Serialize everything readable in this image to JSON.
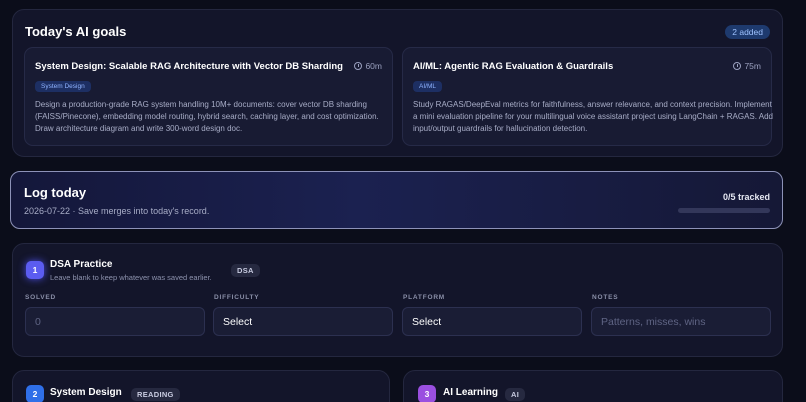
{
  "goals": {
    "title": "Today's AI goals",
    "added_badge": "2 added",
    "items": [
      {
        "title": "System Design: Scalable RAG Architecture with Vector DB Sharding",
        "time": "60m",
        "tag": "System Design",
        "description": "Design a production-grade RAG system handling 10M+ documents: cover vector DB sharding (FAISS/Pinecone), embedding model routing, hybrid search, caching layer, and cost optimization. Draw architecture diagram and write 300-word design doc."
      },
      {
        "title": "AI/ML: Agentic RAG Evaluation & Guardrails",
        "time": "75m",
        "tag": "AI/ML",
        "description": "Study RAGAS/DeepEval metrics for faithfulness, answer relevance, and context precision. Implement a mini evaluation pipeline for your multilingual voice assistant project using LangChain + RAGAS. Add input/output guardrails for hallucination detection."
      }
    ]
  },
  "log": {
    "title": "Log today",
    "subtitle": "2026-07-22 · Save merges into today's record.",
    "tracked": "0/5 tracked",
    "progress_fraction": 0
  },
  "dsa": {
    "number": "1",
    "title": "DSA Practice",
    "subtitle": "Leave blank to keep whatever was saved earlier.",
    "badge": "DSA",
    "fields": {
      "solved_label": "SOLVED",
      "solved_placeholder": "0",
      "difficulty_label": "DIFFICULTY",
      "difficulty_value": "Select",
      "platform_label": "PLATFORM",
      "platform_value": "Select",
      "notes_label": "NOTES",
      "notes_placeholder": "Patterns, misses, wins"
    }
  },
  "system_design": {
    "number": "2",
    "title": "System Design",
    "badge": "READING"
  },
  "ai_learning": {
    "number": "3",
    "title": "AI Learning",
    "badge": "AI"
  },
  "colors": {
    "accent_indigo": "#5b5cf0",
    "system_design_blue": "#2f6fe8",
    "ai_purple": "#9a4fe0",
    "badge_blue": "#1e3a6e"
  },
  "icons": [
    "clock-icon"
  ]
}
